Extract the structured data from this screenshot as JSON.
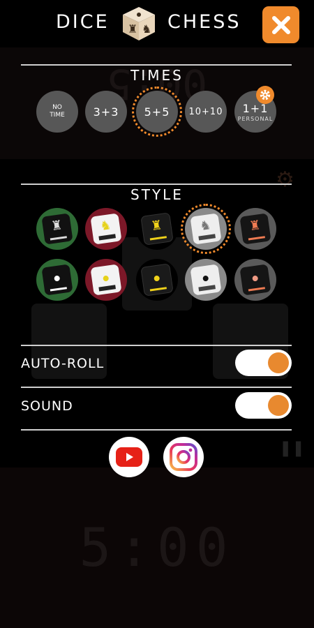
{
  "header": {
    "title_left": "DICE",
    "title_right": "CHESS",
    "logo_icon": "dice-logo-icon",
    "close_icon": "close-icon"
  },
  "times": {
    "title": "TIMES",
    "options": [
      {
        "label": "NO TIME",
        "line1": "NO",
        "line2": "TIME",
        "selected": false
      },
      {
        "label": "3+3",
        "selected": false
      },
      {
        "label": "5+5",
        "selected": true
      },
      {
        "label": "10+10",
        "selected": false
      },
      {
        "label": "1+1",
        "sub": "PERSONAL",
        "selected": false,
        "badge_icon": "gear-icon"
      }
    ]
  },
  "style": {
    "title": "STYLE",
    "selected_index": 3
  },
  "auto_roll": {
    "label": "AUTO-ROLL",
    "on": true
  },
  "sound": {
    "label": "SOUND",
    "on": true
  },
  "social": [
    {
      "name": "youtube",
      "icon": "youtube-icon"
    },
    {
      "name": "instagram",
      "icon": "instagram-icon"
    }
  ],
  "background": {
    "timer_top": "00:5",
    "timer_bottom": "5:00"
  },
  "colors": {
    "accent": "#f08a2c",
    "option_bg": "#575757"
  }
}
